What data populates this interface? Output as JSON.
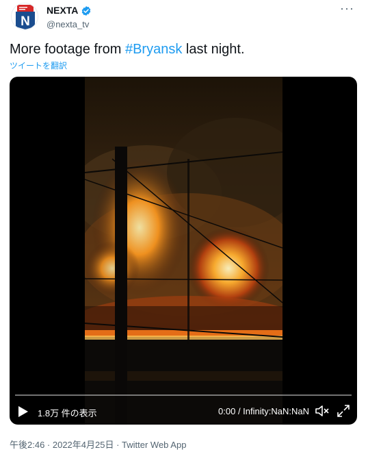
{
  "author": {
    "display_name": "NEXTA",
    "handle": "@nexta_tv",
    "avatar_letter": "N",
    "avatar_icon": "nexta-logo-icon",
    "verified_icon": "verified-badge-icon"
  },
  "more_icon": "more-options-icon",
  "tweet": {
    "text_before": "More footage from ",
    "hashtag": "#Bryansk",
    "text_after": " last night.",
    "translate_label": "ツイートを翻訳"
  },
  "video": {
    "views_label": "1.8万 件の表示",
    "time_label": "0:00 / Infinity:NaN:NaN",
    "progress": 0,
    "play_icon": "play-icon",
    "mute_icon": "mute-icon",
    "fullscreen_icon": "fullscreen-icon"
  },
  "meta": {
    "timestamp": "午後2:46 · 2022年4月25日 · Twitter Web App"
  },
  "colors": {
    "brand_red": "#d62828",
    "brand_blue": "#1a4d8f",
    "link": "#1d9bf0",
    "verified": "#1d9bf0"
  }
}
